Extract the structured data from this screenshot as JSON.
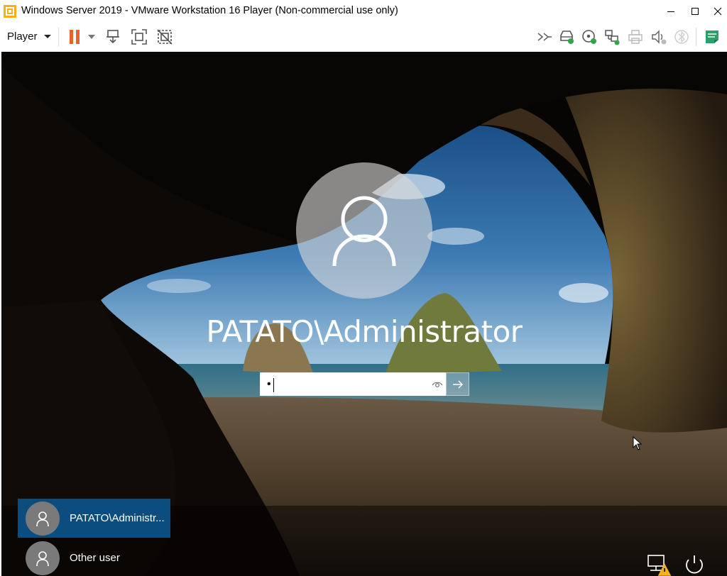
{
  "window": {
    "title": "Windows Server 2019 - VMware Workstation 16 Player (Non-commercial use only)",
    "controls": [
      "minimize",
      "maximize",
      "close"
    ]
  },
  "toolbar": {
    "player_label": "Player",
    "icons": [
      "pause-icon",
      "send-ctrl-alt-del-icon",
      "full-screen-icon",
      "unity-icon",
      "more-devices-icon",
      "hard-disk-icon",
      "cd-dvd-icon",
      "network-adapter-icon",
      "printer-icon",
      "sound-card-icon",
      "bluetooth-icon",
      "message-log-icon"
    ]
  },
  "login": {
    "username": "PATATO\\Administrator",
    "password_value": "•",
    "users": [
      {
        "name": "PATATO\\Administr...",
        "selected": true
      },
      {
        "name": "Other user",
        "selected": false
      }
    ]
  },
  "colors": {
    "selected_tile": "#0a4d7e",
    "pause_orange": "#e8622a",
    "log_green": "#2e9e6a"
  }
}
